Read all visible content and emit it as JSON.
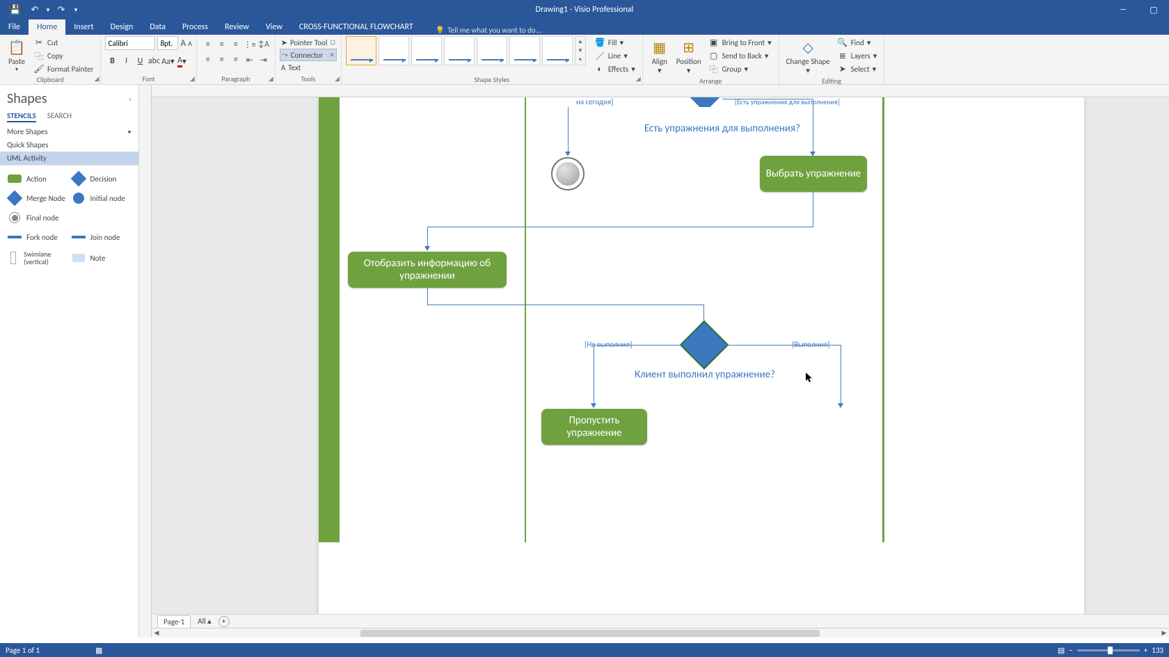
{
  "app": {
    "title": "Drawing1 - Visio Professional"
  },
  "qat": {
    "save": "💾",
    "undo": "↶",
    "redo": "↷",
    "more": "▾"
  },
  "tabs": {
    "file": "File",
    "home": "Home",
    "insert": "Insert",
    "design": "Design",
    "data": "Data",
    "process": "Process",
    "review": "Review",
    "view": "View",
    "contextual": "CROSS-FUNCTIONAL FLOWCHART",
    "tellme": "Tell me what you want to do..."
  },
  "ribbon": {
    "clipboard": {
      "label": "Clipboard",
      "paste": "Paste",
      "cut": "Cut",
      "copy": "Copy",
      "fmt": "Format Painter"
    },
    "font": {
      "label": "Font",
      "name": "Calibri",
      "size": "8pt."
    },
    "paragraph": {
      "label": "Paragraph"
    },
    "tools": {
      "label": "Tools",
      "pointer": "Pointer Tool",
      "connector": "Connector",
      "text": "Text"
    },
    "styles": {
      "label": "Shape Styles",
      "fill": "Fill",
      "line": "Line",
      "effects": "Effects"
    },
    "arrange": {
      "label": "Arrange",
      "align": "Align",
      "position": "Position",
      "btf": "Bring to Front",
      "stb": "Send to Back",
      "group": "Group"
    },
    "editing": {
      "label": "Editing",
      "change": "Change Shape",
      "find": "Find",
      "layers": "Layers",
      "select": "Select"
    }
  },
  "shapes": {
    "title": "Shapes",
    "tab_stencils": "STENCILS",
    "tab_search": "SEARCH",
    "more": "More Shapes",
    "quick": "Quick Shapes",
    "uml": "UML Activity",
    "action": "Action",
    "decision": "Decision",
    "merge": "Merge Node",
    "initial": "Initial node",
    "final": "Final node",
    "fork": "Fork node",
    "join": "Join node",
    "swim": "Swimlane (vertical)",
    "note": "Note"
  },
  "diagram": {
    "topbracket": "на сегодня]",
    "topguard": "[Есть упражнения для выполнения]",
    "q1": "Есть упражнения для выполнения?",
    "pick": "Выбрать упражнение",
    "show": "Отобразить информацию об упражнении",
    "q2": "Клиент выполнил упражнение?",
    "g_no": "[Не выполнил]",
    "g_yes": "[Выполнил]",
    "skip": "Пропустить упражнение"
  },
  "pages": {
    "p1": "Page-1",
    "all": "All"
  },
  "status": {
    "left": "Page 1 of 1",
    "zoom": "133"
  }
}
